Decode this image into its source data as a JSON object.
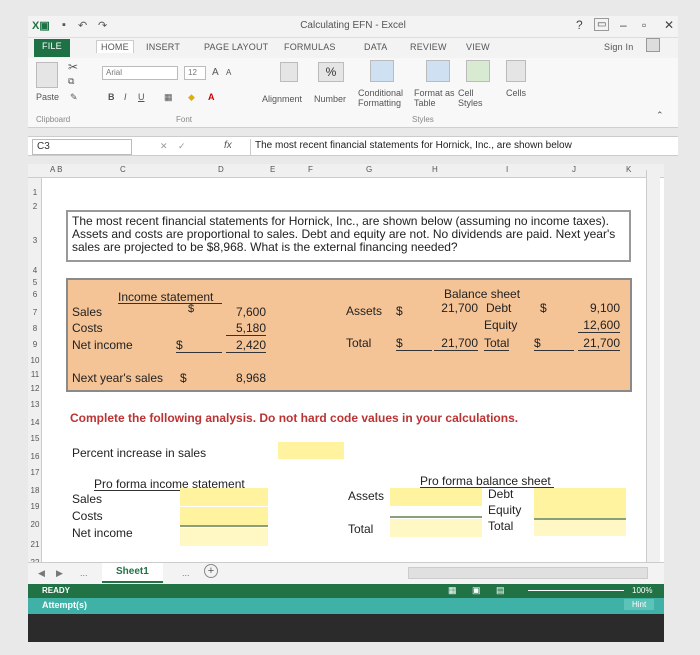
{
  "window": {
    "title": "Calculating EFN - Excel",
    "help": "?",
    "minimize": "–",
    "restore": "▫",
    "close": "✕",
    "sign_in": "Sign In"
  },
  "ribbon_tabs": [
    "FILE",
    "HOME",
    "INSERT",
    "PAGE LAYOUT",
    "FORMULAS",
    "DATA",
    "REVIEW",
    "VIEW"
  ],
  "ribbon": {
    "paste": "Paste",
    "clipboard": "Clipboard",
    "font_name": "Arial",
    "font_size": "12",
    "bold": "B",
    "italic": "I",
    "underline": "U",
    "font_group": "Font",
    "alignment": "Alignment",
    "number": "Number",
    "percent": "%",
    "conditional_formatting": "Conditional Formatting",
    "format_as_table": "Format as Table",
    "cell_styles": "Cell Styles",
    "styles_group": "Styles",
    "cells": "Cells",
    "grow_font": "A",
    "shrink_font": "A"
  },
  "formula_bar": {
    "name_box": "C3",
    "fx": "fx",
    "content": "The most recent financial statements for Hornick, Inc., are shown below"
  },
  "columns": [
    "A B",
    "C",
    "D",
    "E",
    "F",
    "G",
    "H",
    "I",
    "J",
    "K"
  ],
  "rows": [
    "1",
    "2",
    "3",
    "4",
    "5",
    "6",
    "7",
    "8",
    "9",
    "10",
    "11",
    "12",
    "13",
    "14",
    "15",
    "16",
    "17",
    "18",
    "19",
    "20",
    "21",
    "22"
  ],
  "problem_text": "The most recent financial statements for Hornick, Inc., are shown below (assuming no income taxes). Assets and costs are proportional to sales. Debt and equity are not. No dividends are paid. Next year's sales are projected to be $8,968. What is the external financing needed?",
  "income_statement": {
    "title": "Income statement",
    "dollar": "$",
    "sales_label": "Sales",
    "sales": "7,600",
    "costs_label": "Costs",
    "costs": "5,180",
    "net_income_label": "Net income",
    "net_income": "2,420"
  },
  "balance_sheet": {
    "title": "Balance sheet",
    "assets_label": "Assets",
    "assets": "21,700",
    "debt_label": "Debt",
    "debt": "9,100",
    "equity_label": "Equity",
    "equity": "12,600",
    "total_label": "Total",
    "total_assets": "21,700",
    "total_liab_label": "Total",
    "total_liab": "21,700",
    "dollar": "$"
  },
  "next_year": {
    "label": "Next year's sales",
    "dollar": "$",
    "value": "8,968"
  },
  "instruction": "Complete the following analysis. Do not hard code values in your calculations.",
  "analysis": {
    "percent_increase_label": "Percent increase in sales",
    "pro_forma_is_title": "Pro forma income statement",
    "sales_label": "Sales",
    "costs_label": "Costs",
    "net_income_label": "Net income",
    "pro_forma_bs_title": "Pro forma balance sheet",
    "assets_label": "Assets",
    "total_label": "Total",
    "debt_label": "Debt",
    "equity_label": "Equity",
    "total_liab_label": "Total"
  },
  "sheet_tab": "Sheet1",
  "add_sheet": "+",
  "ellipsis": "...",
  "status": "READY",
  "zoom": "100%",
  "attempts": "Attempt(s)",
  "hint": "Hint",
  "colors": {
    "excel_green": "#217346",
    "orange_box": "#f4c396",
    "yellow_input": "#fff3a0",
    "instruction_red": "#b33333"
  }
}
